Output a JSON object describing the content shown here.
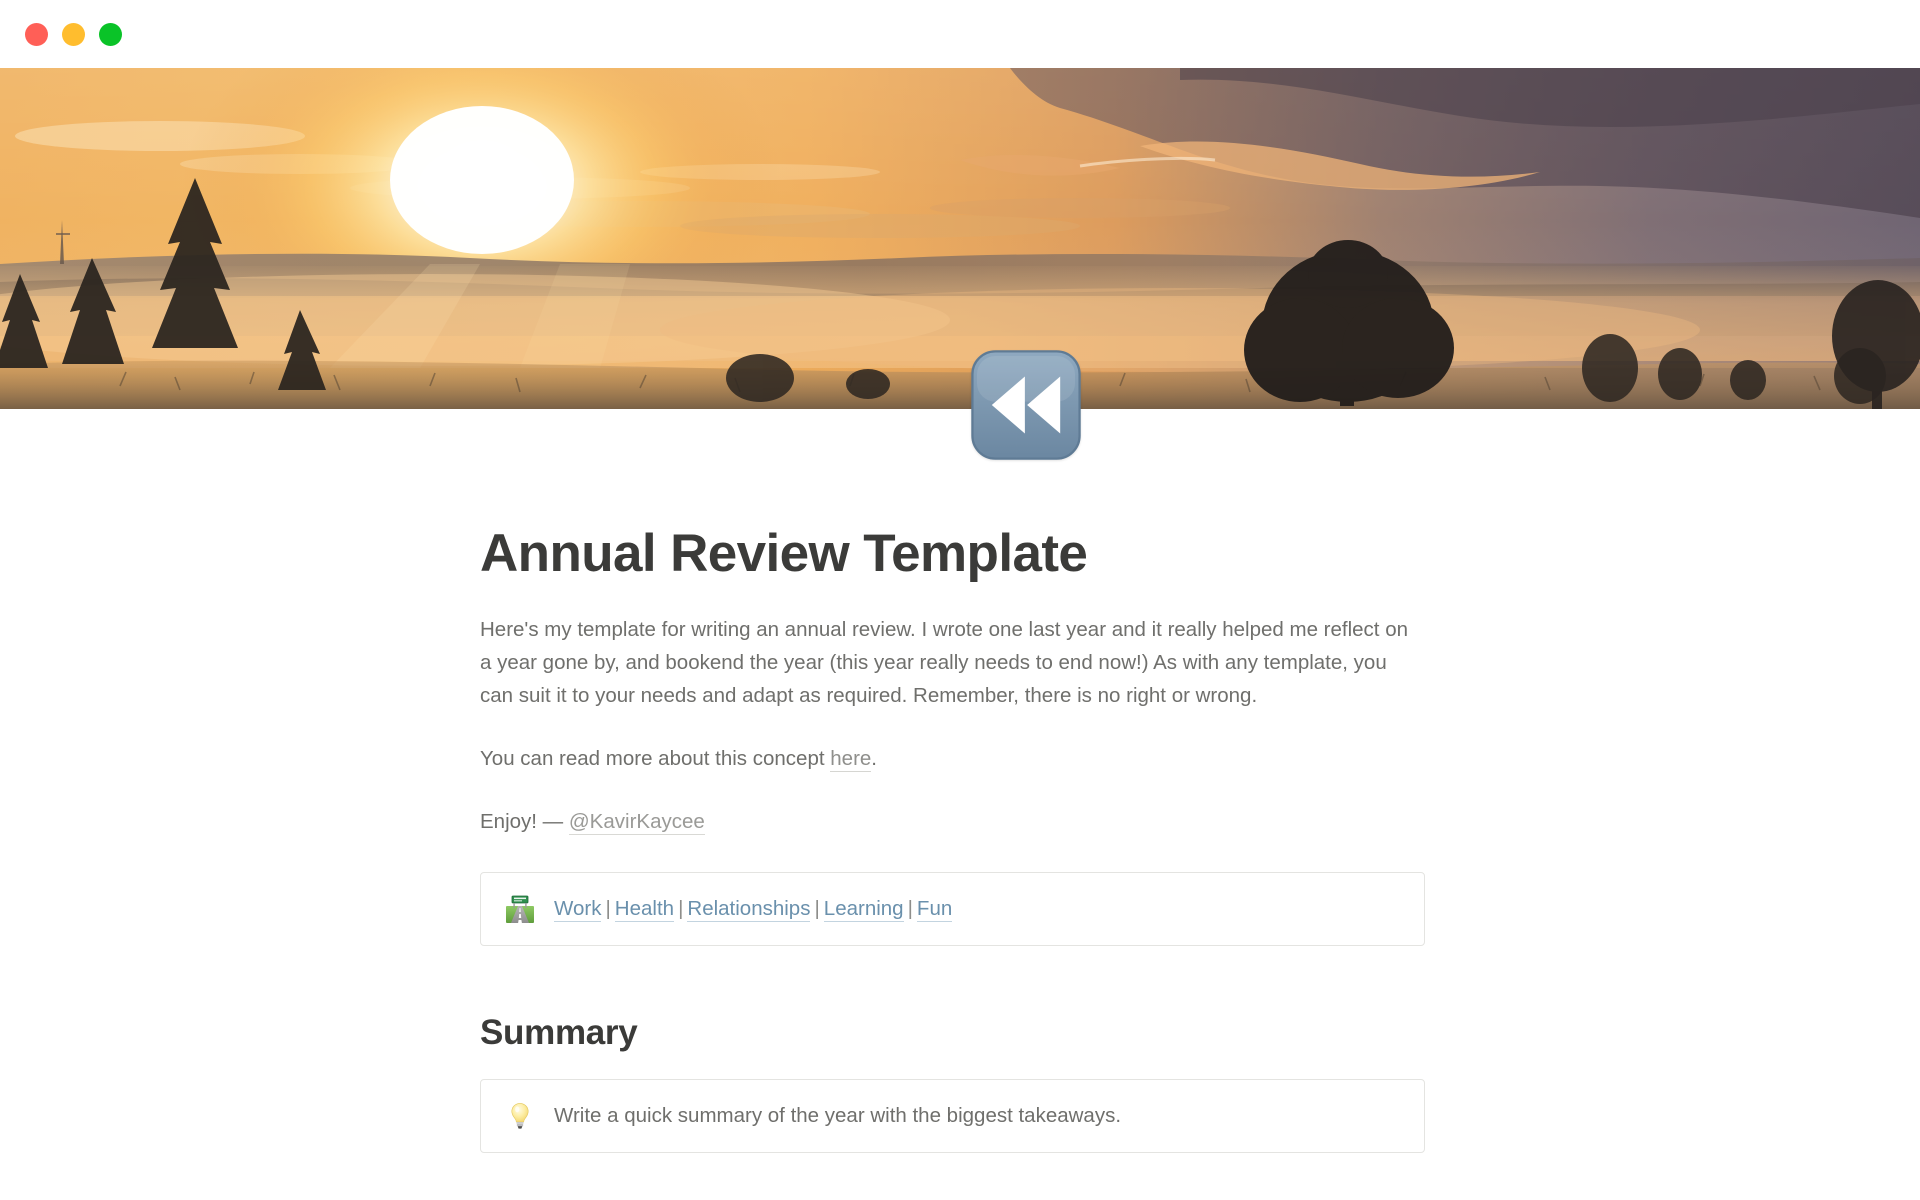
{
  "window": {
    "traffic_lights": [
      {
        "name": "close",
        "color": "#ff5f57"
      },
      {
        "name": "minimize",
        "color": "#ffbd2e"
      },
      {
        "name": "maximize",
        "color": "#0ac328"
      }
    ]
  },
  "cover": {
    "alt": "Sunrise over misty forested hills with silhouetted pine trees",
    "icon": "rewind-emoji"
  },
  "page": {
    "icon_name": "rewind-emoji",
    "title": "Annual Review Template",
    "intro": "Here's my template for writing an annual review. I wrote one last year and it really helped me reflect on a year gone by, and bookend the year (this year really needs to end now!) As with any template, you can suit it to your needs and adapt as required. Remember, there is no right or wrong.",
    "read_more": {
      "before": "You can read more about this concept ",
      "link_label": "here",
      "after": "."
    },
    "signoff": {
      "before": "Enjoy! — ",
      "mention": "@KavirKaycee"
    },
    "nav_callout": {
      "emoji": "motorway-emoji",
      "links": [
        "Work",
        "Health",
        "Relationships",
        "Learning",
        "Fun"
      ],
      "separator": "|"
    },
    "summary": {
      "heading": "Summary",
      "callout": {
        "emoji": "lightbulb-emoji",
        "text": "Write a quick summary of the year with the biggest takeaways."
      }
    }
  },
  "colors": {
    "title": "#3b3b39",
    "body_text": "#6f6f6c",
    "link_blue": "#6a90ac",
    "link_gray": "#8f8f8c",
    "callout_border": "#e4e4e1",
    "icon_blue": "#7b9ab5"
  }
}
